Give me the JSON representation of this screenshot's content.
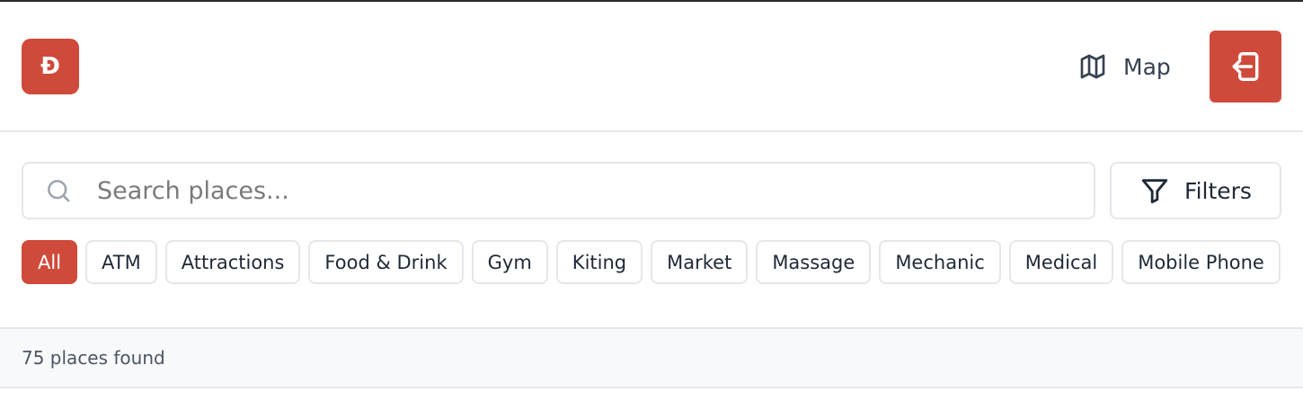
{
  "header": {
    "logo_text": "Đ",
    "map_label": "Map",
    "map_icon": "map-icon",
    "login_icon": "login-icon",
    "accent_color": "#cf4a3a"
  },
  "search": {
    "placeholder": "Search places...",
    "value": "",
    "icon": "search-icon"
  },
  "filters": {
    "label": "Filters",
    "icon": "filter-icon"
  },
  "categories": [
    {
      "label": "All",
      "active": true
    },
    {
      "label": "ATM",
      "active": false
    },
    {
      "label": "Attractions",
      "active": false
    },
    {
      "label": "Food & Drink",
      "active": false
    },
    {
      "label": "Gym",
      "active": false
    },
    {
      "label": "Kiting",
      "active": false
    },
    {
      "label": "Market",
      "active": false
    },
    {
      "label": "Massage",
      "active": false
    },
    {
      "label": "Mechanic",
      "active": false
    },
    {
      "label": "Medical",
      "active": false
    },
    {
      "label": "Mobile Phone",
      "active": false
    }
  ],
  "results": {
    "count_text": "75 places found"
  }
}
